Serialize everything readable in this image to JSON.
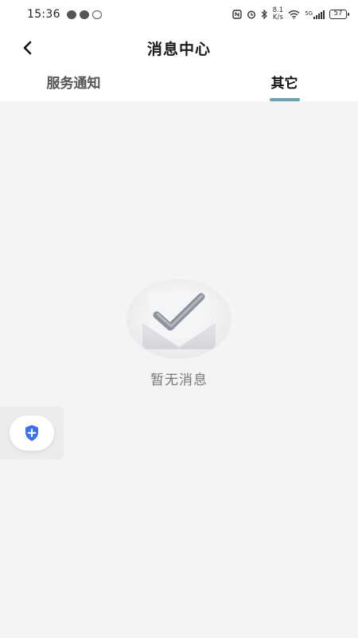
{
  "status_bar": {
    "time": "15:36",
    "net_speed_value": "8.1",
    "net_speed_unit": "K/s",
    "network_type": "5G",
    "battery": "57"
  },
  "header": {
    "title": "消息中心"
  },
  "tabs": [
    {
      "label": "服务通知",
      "active": false
    },
    {
      "label": "其它",
      "active": true
    }
  ],
  "empty_state": {
    "message": "暂无消息"
  },
  "colors": {
    "accent": "#6aa3ae",
    "background": "#f4f4f4",
    "float_icon": "#3d6ff0"
  },
  "icons": {
    "back": "chevron-left-icon",
    "empty": "inbox-check-icon",
    "float": "shield-plus-icon"
  }
}
